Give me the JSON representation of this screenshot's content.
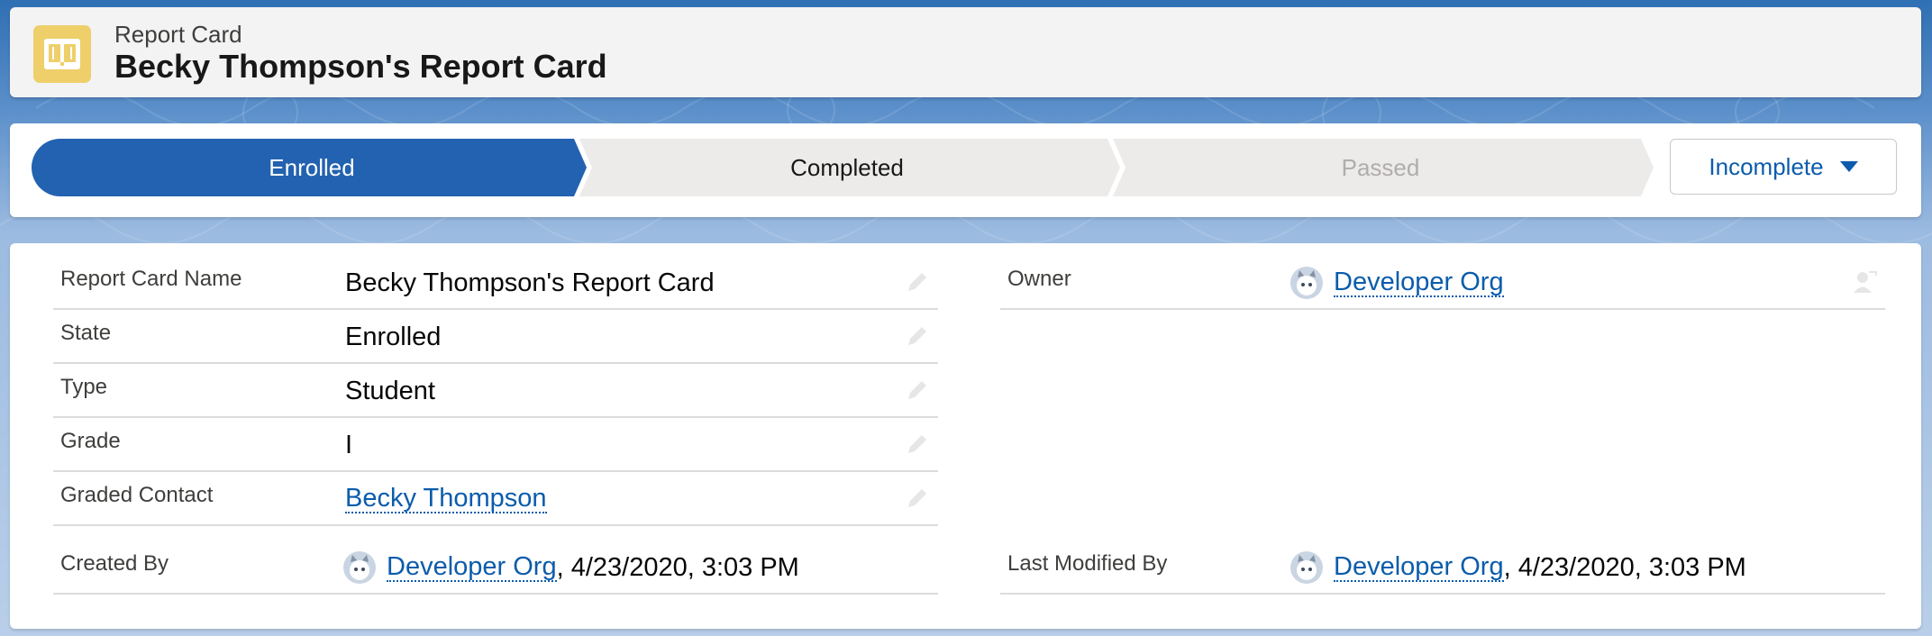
{
  "header": {
    "object_type": "Report Card",
    "record_title": "Becky Thompson's Report Card",
    "icon": "report-card-book-icon"
  },
  "path": {
    "stages": [
      {
        "label": "Enrolled",
        "state": "current"
      },
      {
        "label": "Completed",
        "state": "incomplete"
      },
      {
        "label": "Passed",
        "state": "disabled"
      }
    ],
    "mark_button": {
      "label": "Incomplete",
      "icon": "chevron-down-icon"
    }
  },
  "fields": {
    "name": {
      "label": "Report Card Name",
      "value": "Becky Thompson's Report Card"
    },
    "state": {
      "label": "State",
      "value": "Enrolled"
    },
    "type": {
      "label": "Type",
      "value": "Student"
    },
    "grade": {
      "label": "Grade",
      "value": "I"
    },
    "graded_contact": {
      "label": "Graded Contact",
      "value": "Becky Thompson"
    },
    "created_by": {
      "label": "Created By",
      "user": "Developer Org",
      "timestamp": ", 4/23/2020, 3:03 PM"
    },
    "owner": {
      "label": "Owner",
      "user": "Developer Org"
    },
    "last_modified_by": {
      "label": "Last Modified By",
      "user": "Developer Org",
      "timestamp": ", 4/23/2020, 3:03 PM"
    }
  },
  "colors": {
    "brand_blue": "#2262b0",
    "link": "#0b5cab",
    "icon_yellow": "#eecf6a",
    "stage_gray": "#ecebea",
    "disabled_text": "#b0adab"
  }
}
